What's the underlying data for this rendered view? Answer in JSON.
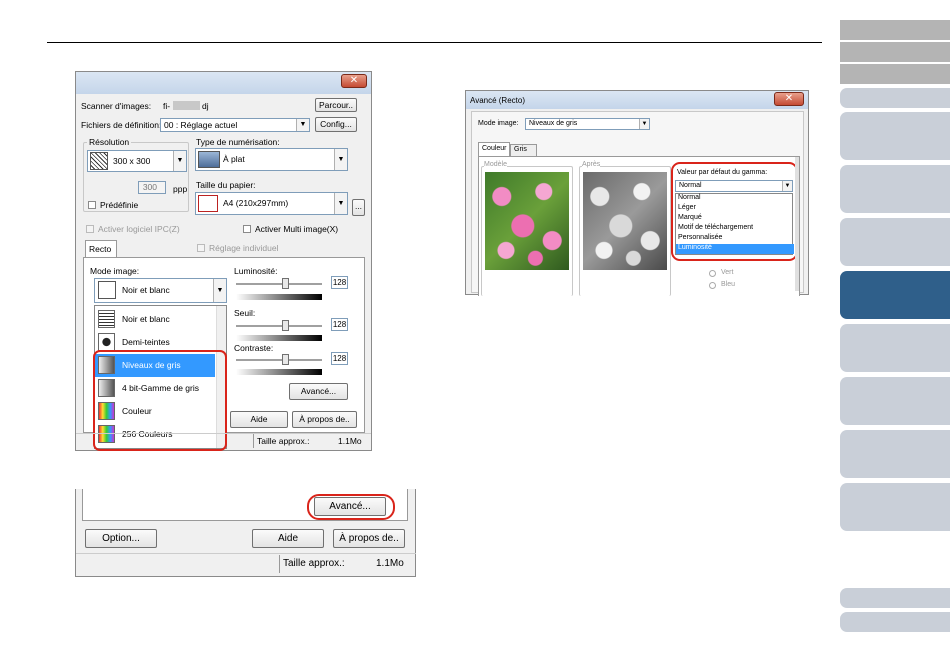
{
  "nav_tabs": [
    {
      "state": "gray"
    },
    {
      "state": "gray"
    },
    {
      "state": "gray"
    },
    {
      "state": "light"
    },
    {
      "state": "light"
    },
    {
      "state": "light"
    },
    {
      "state": "light"
    },
    {
      "state": "active"
    },
    {
      "state": "light"
    },
    {
      "state": "light"
    },
    {
      "state": "light"
    },
    {
      "state": "light"
    },
    {
      "state": "light"
    },
    {
      "state": "light"
    }
  ],
  "dialog_main": {
    "close_glyph": "✕",
    "scanner_label": "Scanner d'images:",
    "scanner_value": "fi-",
    "scanner_suffix": "dj",
    "browse_button": "Parcour..",
    "definition_label": "Fichiers de définition:",
    "definition_value": "00 : Réglage actuel",
    "config_button": "Config...",
    "resolution_group": "Résolution",
    "resolution_value": "300 x 300",
    "resolution_spin": "300",
    "ppp": "ppp",
    "predefined_label": "Prédéfinie",
    "scan_type_label": "Type de numérisation:",
    "scan_type_value": "À plat",
    "paper_label": "Taille du papier:",
    "paper_value": "A4 (210x297mm)",
    "paper_more": "...",
    "ipc_label": "Activer logiciel IPC(Z)",
    "multi_image_label": "Activer Multi image(X)",
    "recto_tab": "Recto",
    "individual_label": "Réglage individuel",
    "mode_label": "Mode image:",
    "mode_value": "Noir et blanc",
    "mode_options": [
      {
        "label": "Noir et blanc",
        "icon": "text-doc-icon",
        "selected": false
      },
      {
        "label": "Demi-teintes",
        "icon": "people-icon",
        "selected": false
      },
      {
        "label": "Niveaux de gris",
        "icon": "grayscale-icon",
        "selected": true
      },
      {
        "label": "4 bit-Gamme de gris",
        "icon": "grayscale-4bit-icon",
        "selected": false
      },
      {
        "label": "Couleur",
        "icon": "color-icon",
        "selected": false
      },
      {
        "label": "256 Couleurs",
        "icon": "color-256-icon",
        "selected": false
      }
    ],
    "brightness_label": "Luminosité:",
    "brightness_value": "128",
    "threshold_label": "Seuil:",
    "threshold_value": "128",
    "contrast_label": "Contraste:",
    "contrast_value": "128",
    "advanced_button": "Avancé...",
    "help_button": "Aide",
    "about_button": "À propos de..",
    "size_label": "Taille approx.:",
    "size_value": "1.1Mo"
  },
  "dialog_zoom": {
    "advanced_button": "Avancé...",
    "option_button": "Option...",
    "help_button": "Aide",
    "about_button": "À propos de..",
    "size_label": "Taille approx.:",
    "size_value": "1.1Mo"
  },
  "dialog_advanced": {
    "title": "Avancé (Recto)",
    "close_glyph": "✕",
    "mode_label": "Mode image:",
    "mode_value": "Niveaux de gris",
    "tabs": [
      "Couleur",
      "Gris"
    ],
    "before_label": "Modèle",
    "after_label": "Après",
    "gamma_label": "Valeur par défaut du gamma:",
    "gamma_value": "Normal",
    "gamma_options": [
      {
        "label": "Normal",
        "selected": false
      },
      {
        "label": "Léger",
        "selected": false
      },
      {
        "label": "Marqué",
        "selected": false
      },
      {
        "label": "Motif de téléchargement",
        "selected": false
      },
      {
        "label": "Personnalisée",
        "selected": false
      },
      {
        "label": "Luminosité",
        "selected": true
      }
    ],
    "radio_partial": "",
    "radio_green": "Vert",
    "radio_blue": "Bleu"
  }
}
